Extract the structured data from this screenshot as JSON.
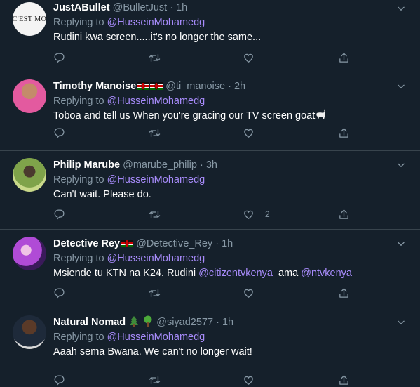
{
  "colors": {
    "background": "#15202b",
    "divider": "#38444d",
    "secondary_text": "#8899a6",
    "mention": "#a78bfa"
  },
  "tweets": [
    {
      "name": "JustABullet",
      "handle": "@BulletJust",
      "time": "1h",
      "replying_prefix": "Replying to",
      "replying_to": "@HusseinMohamedg",
      "text": "Rudini kwa screen.....it's no longer the same...",
      "avatar_text": "C'EST MO",
      "like_count": ""
    },
    {
      "name": "Timothy Manoise",
      "handle": "@ti_manoise",
      "time": "2h",
      "replying_prefix": "Replying to",
      "replying_to": "@HusseinMohamedg",
      "text": "Toboa and tell us When you're gracing our TV screen goat",
      "emoji": "goat",
      "like_count": ""
    },
    {
      "name": "Philip Marube",
      "handle": "@marube_philip",
      "time": "3h",
      "replying_prefix": "Replying to",
      "replying_to": "@HusseinMohamedg",
      "text": "Can't wait. Please do.",
      "like_count": "2"
    },
    {
      "name": "Detective Rey",
      "handle": "@Detective_Rey",
      "time": "1h",
      "replying_prefix": "Replying to",
      "replying_to": "@HusseinMohamedg",
      "text_before": "Msiende tu KTN na K24. Rudini ",
      "mention_1": "@citizentvkenya",
      "text_middle": "  ama ",
      "mention_2": "@ntvkenya",
      "like_count": ""
    },
    {
      "name": "Natural Nomad",
      "handle": "@siyad2577",
      "time": "1h",
      "replying_prefix": "Replying to",
      "replying_to": "@HusseinMohamedg",
      "text": "Aaah sema Bwana. We can't no longer wait!",
      "like_count": ""
    }
  ],
  "separator": "·",
  "icons": [
    "reply-icon",
    "retweet-icon",
    "like-icon",
    "share-icon",
    "chevron-down-icon"
  ]
}
